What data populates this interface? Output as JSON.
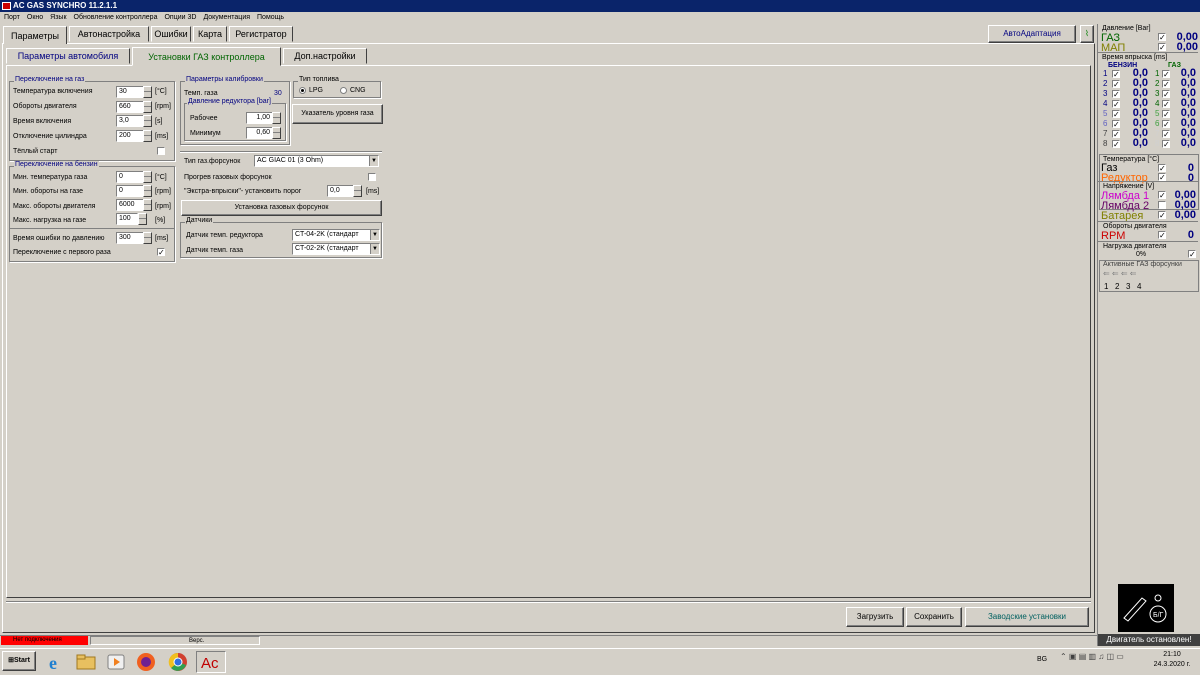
{
  "window": {
    "title": "AC GAS SYNCHRO  11.2.1.1"
  },
  "menu": [
    "Порт",
    "Окно",
    "Язык",
    "Обновление контроллера",
    "Опции 3D",
    "Документация",
    "Помощь"
  ],
  "main_tabs": [
    "Параметры",
    "Автонастройка",
    "Ошибки",
    "Карта",
    "Регистратор"
  ],
  "autoadapt": "АвтоАдаптация",
  "sub_tabs": [
    "Параметры автомобиля",
    "Установки ГАЗ контроллера",
    "Доп.настройки"
  ],
  "switch_gas": {
    "title": "Переключение на газ",
    "rows": [
      {
        "label": "Температура включения",
        "value": "30",
        "unit": "[°C]"
      },
      {
        "label": "Обороты двигателя",
        "value": "660",
        "unit": "[rpm]"
      },
      {
        "label": "Время включения",
        "value": "3,0",
        "unit": "[s]"
      },
      {
        "label": "Отключение цилиндра",
        "value": "200",
        "unit": "[ms]"
      }
    ],
    "warm_start": "Тёплый старт"
  },
  "switch_petrol": {
    "title": "Переключение на бензин",
    "rows": [
      {
        "label": "Мин. температура газа",
        "value": "0",
        "unit": "[°C]"
      },
      {
        "label": "Мин. обороты на газе",
        "value": "0",
        "unit": "[rpm]"
      },
      {
        "label": "Макс. обороты двигателя",
        "value": "6000",
        "unit": "[rpm]"
      },
      {
        "label": "Макс. нагрузка на газе",
        "value": "100",
        "unit": "[%]"
      },
      {
        "label": "Время ошибки по давлению",
        "value": "300",
        "unit": "[ms]"
      }
    ],
    "first_time": "Переключение с первого раза",
    "first_time_mark": "✓"
  },
  "calibration": {
    "title": "Параметры калибровки",
    "gas_temp_label": "Темп. газа",
    "gas_temp_value": "30",
    "pressure_title": "Давление редуктора [bar]",
    "work_label": "Рабочее",
    "work_value": "1,00",
    "min_label": "Минимум",
    "min_value": "0,60"
  },
  "fuel": {
    "title": "Тип топлива",
    "lpg": "LPG",
    "cng": "CNG"
  },
  "level_button": "Указатель уровня газа",
  "injectors": {
    "type_label": "Тип газ.форсунок",
    "type_value": "AC GIAC 01 (3 Ohm)",
    "preheat_label": "Прогрев газовых форсунок",
    "extra_label": "\"Экстра-впрыски\"- установить порог",
    "extra_value": "0,0",
    "extra_unit": "[ms]",
    "install_button": "Установка газовых форсунок"
  },
  "sensors": {
    "title": "Датчики",
    "reducer_label": "Датчик темп. редуктора",
    "reducer_value": "CT-04-2K (стандарт",
    "gas_label": "Датчик темп. газа",
    "gas_value": "CT-02-2K (стандарт"
  },
  "bottom_buttons": {
    "load": "Загрузить",
    "save": "Сохранить",
    "factory": "Заводские установки"
  },
  "right_panel": {
    "pressure_title": "Давление [Bar]",
    "gas_label": "ГАЗ",
    "gas_value": "0,00",
    "map_label": "МАП",
    "map_value": "0,00",
    "inject_title": "Время впрыска [ms]",
    "petrol_header": "БЕНЗИН",
    "gas_header": "ГАЗ",
    "petrol_rows": [
      {
        "n": "1",
        "v": "0,0"
      },
      {
        "n": "2",
        "v": "0,0"
      },
      {
        "n": "3",
        "v": "0,0"
      },
      {
        "n": "4",
        "v": "0,0"
      },
      {
        "n": "5",
        "v": "0,0"
      },
      {
        "n": "6",
        "v": "0,0"
      },
      {
        "n": "7",
        "v": "0,0"
      },
      {
        "n": "8",
        "v": "0,0"
      }
    ],
    "gas_rows": [
      {
        "n": "1",
        "v": "0,0"
      },
      {
        "n": "2",
        "v": "0,0"
      },
      {
        "n": "3",
        "v": "0,0"
      },
      {
        "n": "4",
        "v": "0,0"
      },
      {
        "n": "5",
        "v": "0,0"
      },
      {
        "n": "6",
        "v": "0,0"
      },
      {
        "n": "7",
        "v": "0,0"
      },
      {
        "n": "8",
        "v": "0,0"
      }
    ],
    "temp_title": "Температура   [°C]",
    "temp_gas_label": "Газ",
    "temp_gas_value": "0",
    "temp_red_label": "Редуктор",
    "temp_red_value": "0",
    "volt_title": "Напряжение [V]",
    "lambda1_label": "Лямбда 1",
    "lambda1_value": "0,00",
    "lambda2_label": "Лямбда 2",
    "lambda2_value": "0,00",
    "battery_label": "Батарея",
    "battery_value": "0,00",
    "rpm_title": "Обороты двигателя",
    "rpm_label": "RPM",
    "rpm_value": "0",
    "load_title": "Нагрузка двигателя",
    "load_value": "0%",
    "active_title": "Активные ГАЗ форсунки",
    "active_nums": [
      "1",
      "2",
      "3",
      "4"
    ],
    "logo_text": "Б/Г",
    "engine_status": "Двигатель остановлен!"
  },
  "status": {
    "not_connected": "Нет подключения",
    "version": "Верс."
  },
  "taskbar": {
    "start": "Start",
    "lang": "BG",
    "time": "21:10",
    "date": "24.3.2020 г."
  },
  "colors": {
    "gas": "#006400",
    "map": "#808000",
    "lambda": "#cc00cc",
    "temp_red": "#ff6600",
    "rpm": "#cc0000",
    "value": "#000080",
    "error": "#ff0000"
  }
}
